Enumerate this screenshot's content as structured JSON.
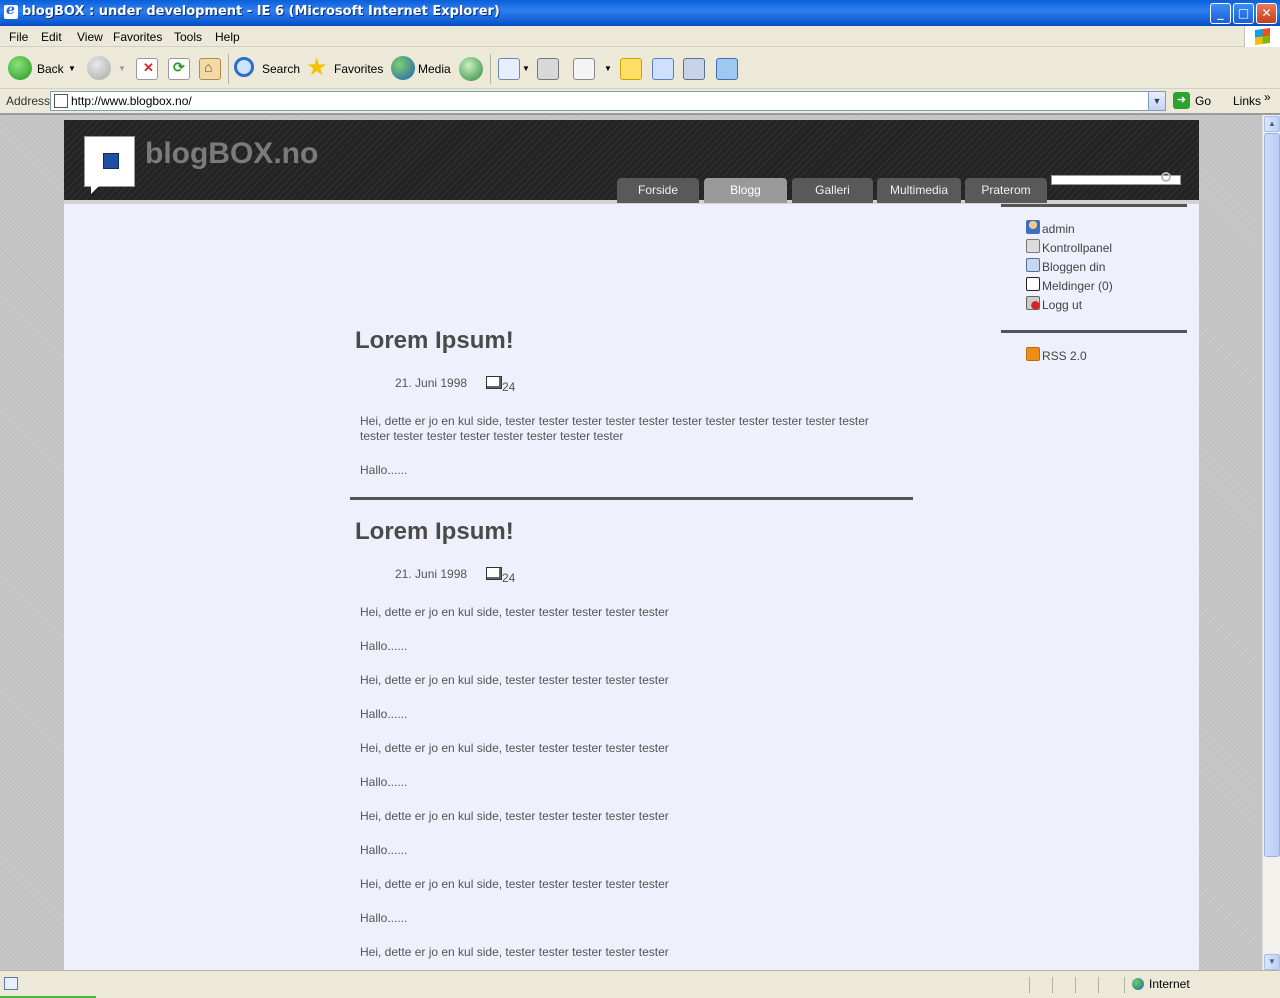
{
  "window": {
    "title": "blogBOX : under development - IE 6 (Microsoft Internet Explorer)",
    "buttons": {
      "minimize": "_",
      "maximize": "□",
      "close": "✕"
    }
  },
  "menu": [
    "File",
    "Edit",
    "View",
    "Favorites",
    "Tools",
    "Help"
  ],
  "toolbar": {
    "back_label": "Back",
    "search_label": "Search",
    "favorites_label": "Favorites",
    "media_label": "Media"
  },
  "address": {
    "label": "Address",
    "url": "http://www.blogbox.no/",
    "go_label": "Go",
    "links_label": "Links",
    "links_chevron": "»"
  },
  "site": {
    "title": "blogBOX.no",
    "nav": [
      "Forside",
      "Blogg",
      "Galleri",
      "Multimedia",
      "Praterom"
    ],
    "active_nav": "Blogg"
  },
  "posts": [
    {
      "title": "Lorem Ipsum!",
      "date": "21. Juni 1998",
      "comments": "24",
      "paragraphs": [
        "Hei, dette er jo en kul side, tester tester tester tester tester tester tester tester tester tester tester tester tester tester tester tester tester tester tester",
        "Hallo......"
      ]
    },
    {
      "title": "Lorem Ipsum!",
      "date": "21. Juni 1998",
      "comments": "24",
      "paragraphs": [
        "Hei, dette er jo en kul side, tester tester tester tester tester",
        "Hallo......",
        "Hei, dette er jo en kul side, tester tester tester tester tester",
        "Hallo......",
        "Hei, dette er jo en kul side, tester tester tester tester tester",
        "Hallo......",
        "Hei, dette er jo en kul side, tester tester tester tester tester",
        "Hallo......",
        "Hei, dette er jo en kul side, tester tester tester tester tester",
        "Hallo......",
        "Hei, dette er jo en kul side, tester tester tester tester tester"
      ]
    }
  ],
  "sidebar": {
    "user_links": [
      "admin",
      "Kontrollpanel",
      "Bloggen din",
      "Meldinger (0)",
      "Logg ut"
    ],
    "rss": "RSS 2.0"
  },
  "status": {
    "zone": "Internet"
  },
  "colors": {
    "title_bar": "#0a5fd8",
    "page_bg": "#eef0fb",
    "header_bg": "#2c2c2c",
    "nav_tab": "#595959",
    "nav_tab_active": "#9a9a9a"
  }
}
